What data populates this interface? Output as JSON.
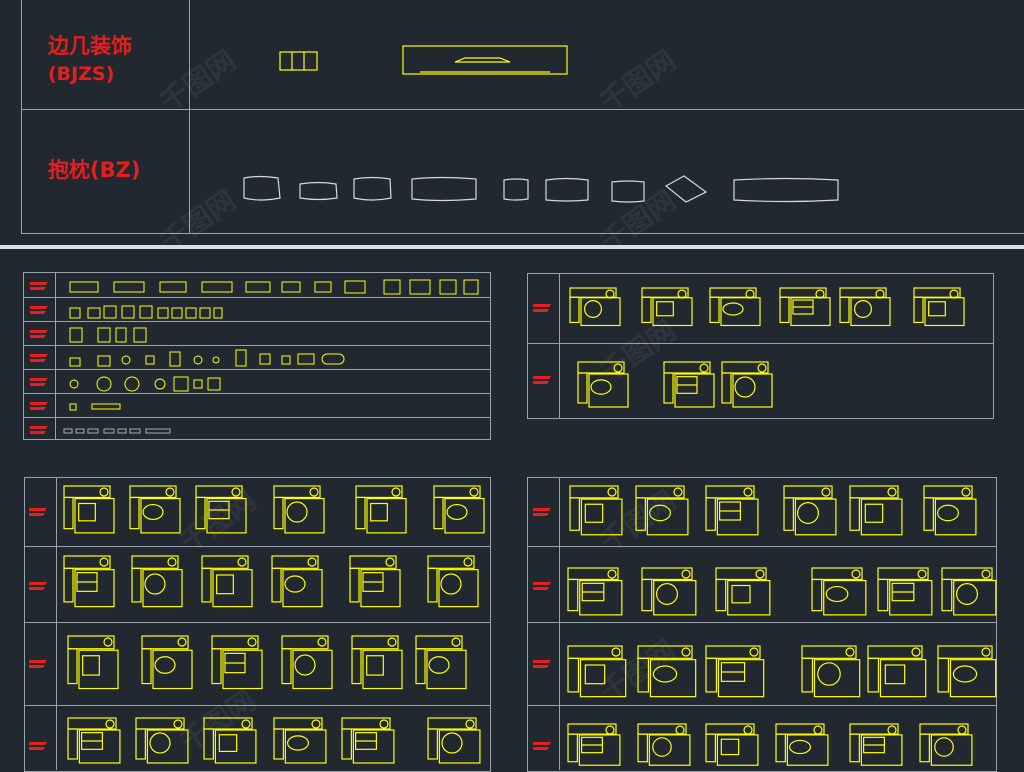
{
  "top_section": {
    "categories": [
      {
        "name": "边几装饰",
        "code": "(BJZS)"
      },
      {
        "name": "抱枕(BZ)"
      }
    ]
  },
  "watermark": "千图网",
  "colors": {
    "background": "#212830",
    "outline": "#ffff00",
    "pillow_outline": "#d9d9d9",
    "category_red": "#e81e1e",
    "frame": "#9aa2ad"
  },
  "blocks": {
    "legend": {
      "row_count": 7
    },
    "top_right": {
      "row_count": 2
    },
    "bottom_left": {
      "row_count": 4
    },
    "bottom_right": {
      "row_count": 4
    }
  }
}
